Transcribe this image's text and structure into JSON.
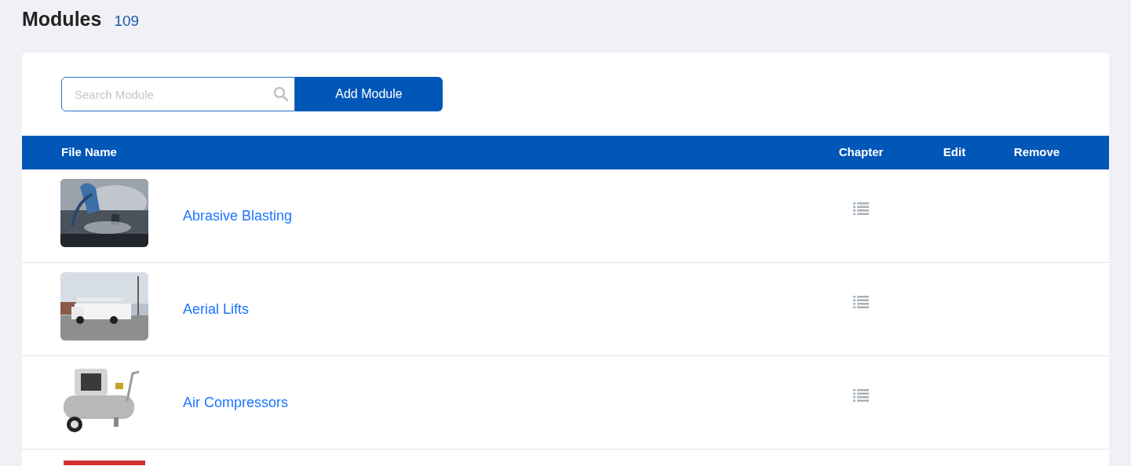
{
  "page": {
    "title": "Modules",
    "count": "109"
  },
  "search": {
    "placeholder": "Search Module"
  },
  "add_button": "Add Module",
  "table": {
    "columns": [
      "File Name",
      "Chapter",
      "Edit",
      "Remove"
    ],
    "rows": [
      {
        "name": "Abrasive Blasting",
        "thumbnail": {
          "kind": "picture"
        }
      },
      {
        "name": "Aerial Lifts",
        "thumbnail": {
          "kind": "picture"
        }
      },
      {
        "name": "Air Compressors",
        "thumbnail": {
          "kind": "picture"
        }
      },
      {
        "thumbnail": {
          "kind": "picture"
        }
      }
    ]
  }
}
